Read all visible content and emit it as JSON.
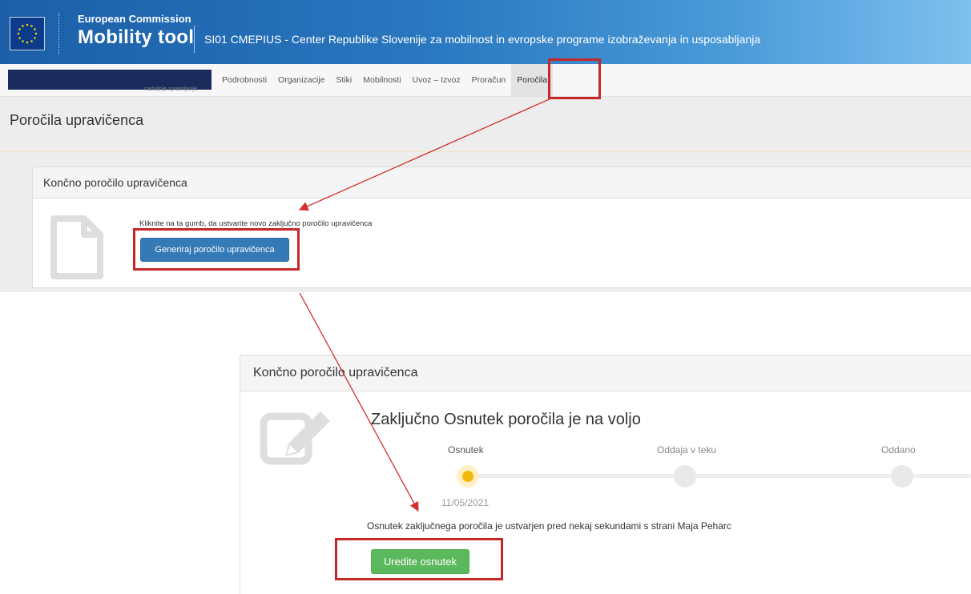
{
  "header": {
    "ec_label": "European Commission",
    "app_name": "Mobility tool",
    "organization": "SI01 CMEPIUS - Center Republike Slovenije za mobilnost in evropske programe izobraževanja in usposabljanja"
  },
  "nav": {
    "user_sub": "nadaljnje spremljanje",
    "tabs": [
      {
        "label": "Podrobnosti"
      },
      {
        "label": "Organizacije"
      },
      {
        "label": "Stiki"
      },
      {
        "label": "Mobilnosti"
      },
      {
        "label": "Uvoz – Izvoz"
      },
      {
        "label": "Proračun"
      },
      {
        "label": "Poročila"
      }
    ]
  },
  "page": {
    "title": "Poročila upravičenca"
  },
  "panel_generate": {
    "heading": "Končno poročilo upravičenca",
    "hint": "Kliknite na ta gumb, da ustvarite novo zaključno poročilo upravičenca",
    "button_label": "Generiraj poročilo upravičenca"
  },
  "panel_draft": {
    "heading": "Končno poročilo upravičenca",
    "status_title": "Zaključno Osnutek poročila je na voljo",
    "steps": [
      {
        "label": "Osnutek"
      },
      {
        "label": "Oddaja v teku"
      },
      {
        "label": "Oddano"
      }
    ],
    "current_step_date": "11/05/2021",
    "created_text": "Osnutek zaključnega poročila je ustvarjen pred nekaj sekundami s strani Maja Peharc",
    "edit_button_label": "Uredite osnutek"
  },
  "colors": {
    "header_blue": "#1b5fa8",
    "primary_button": "#337ab7",
    "success_button": "#5cb85c",
    "active_step": "#f5b80c",
    "annotation_red": "#c62828"
  },
  "icons": {
    "eu_flag": "eu-flag-icon",
    "document": "document-icon",
    "edit": "edit-document-icon"
  }
}
